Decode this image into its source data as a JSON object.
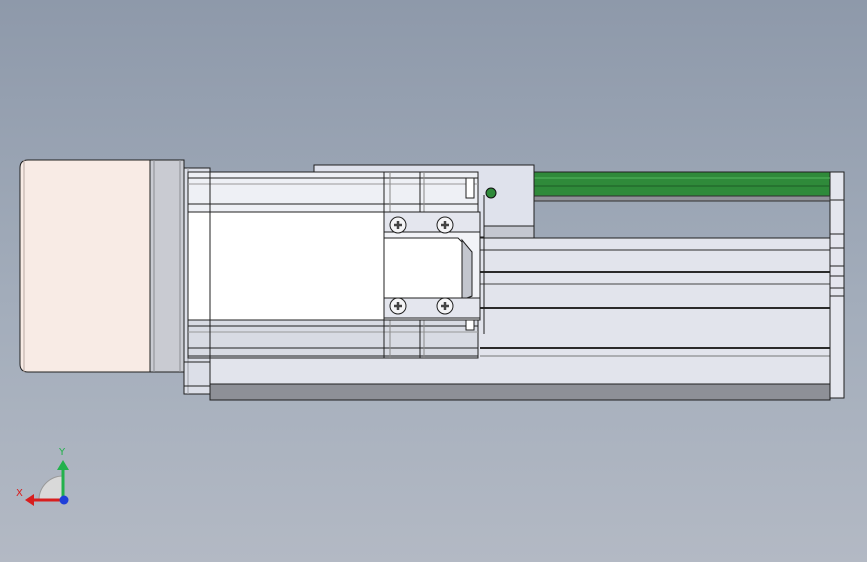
{
  "viewport": {
    "background_top": "#8e99aa",
    "background_bottom": "#b3b9c4"
  },
  "triad": {
    "x_label": "X",
    "y_label": "Y",
    "x_color": "#d81e1e",
    "y_color": "#22b14c",
    "z_color": "#1f3fd9"
  },
  "model": {
    "motor_color": "#f8ebe5",
    "rail_color": "#2f8a3a",
    "body_color": "#dde0ea",
    "edge_color": "#202020"
  }
}
